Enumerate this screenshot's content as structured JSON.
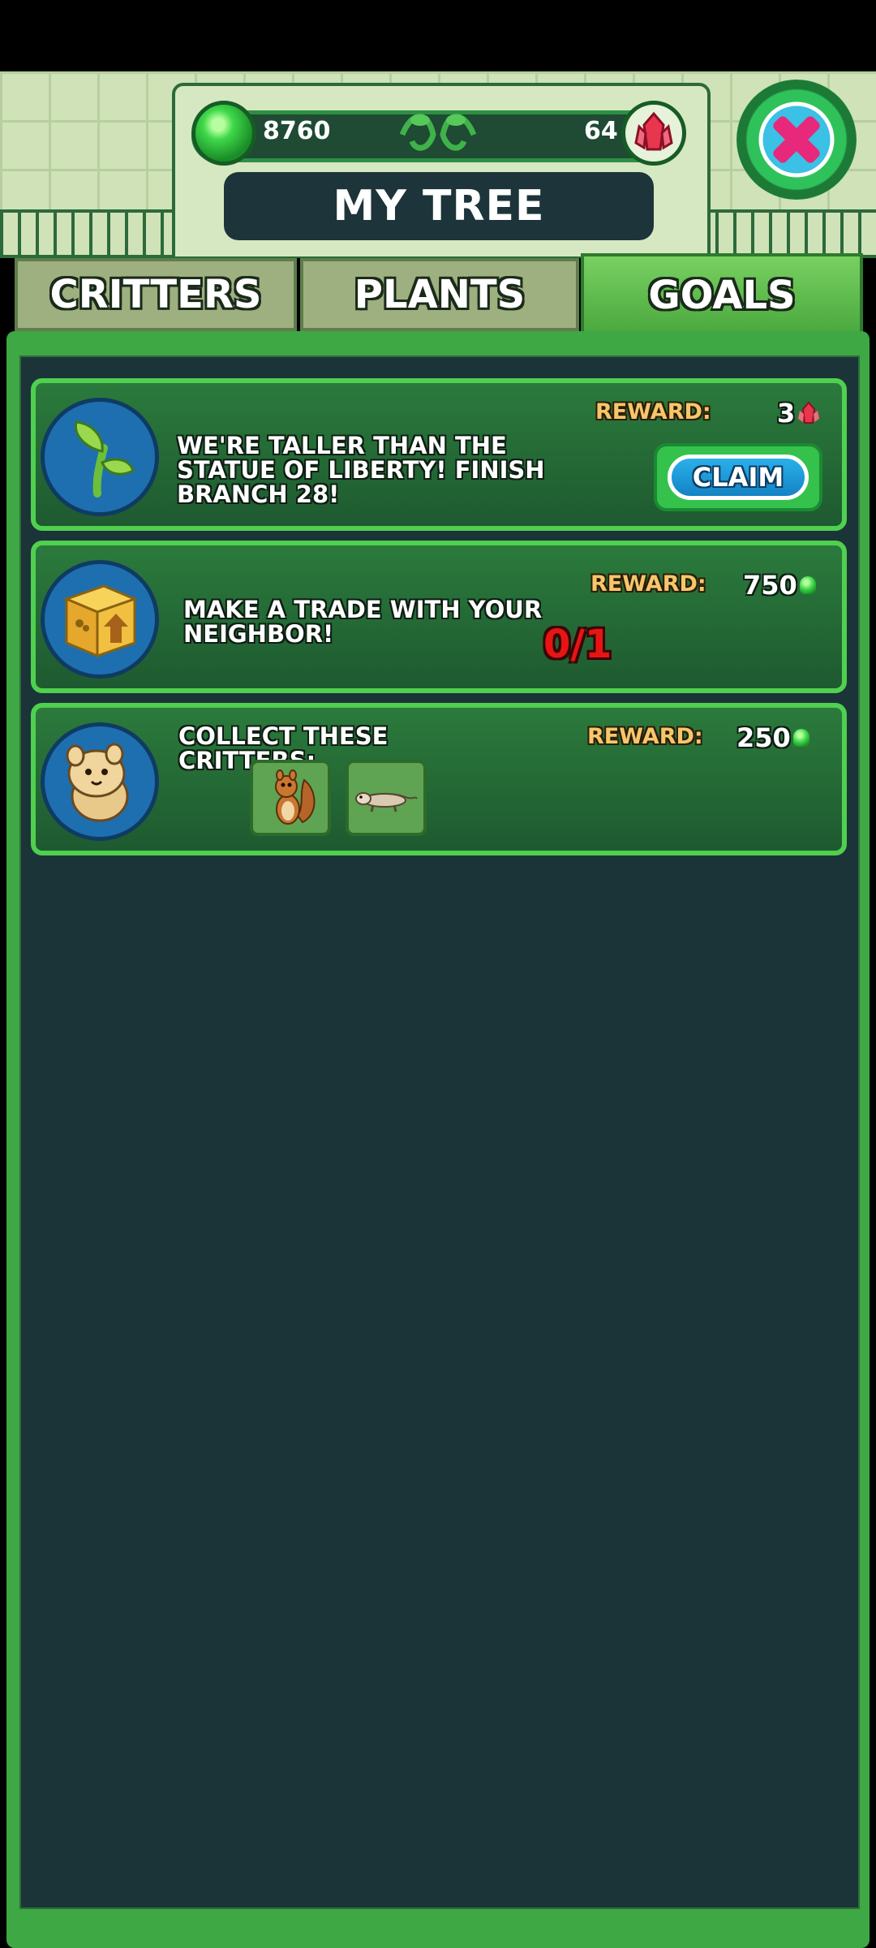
{
  "header": {
    "title": "MY TREE",
    "green_gems": "8760",
    "red_gems": "64"
  },
  "tabs": [
    {
      "label": "CRITTERS",
      "active": false
    },
    {
      "label": "PLANTS",
      "active": false
    },
    {
      "label": "GOALS",
      "active": true
    }
  ],
  "goals": [
    {
      "icon": "sprout-icon",
      "text": "WE'RE TALLER THAN THE STATUE OF LIBERTY!  FINISH BRANCH 28!",
      "reward_label": "REWARD:",
      "reward_value": "3",
      "reward_icon": "red-gem-icon",
      "button_label": "CLAIM"
    },
    {
      "icon": "trade-box-icon",
      "text": "MAKE A TRADE WITH YOUR NEIGHBOR!",
      "reward_label": "REWARD:",
      "reward_value": "750",
      "reward_icon": "green-gem-icon",
      "progress": "0/1"
    },
    {
      "icon": "critter-icon",
      "text": "COLLECT THESE CRITTERS:",
      "reward_label": "REWARD:",
      "reward_value": "250",
      "reward_icon": "green-gem-icon",
      "critters": [
        "squirrel-icon",
        "ferret-icon"
      ]
    }
  ],
  "colors": {
    "panel_bg": "#1b3438",
    "card_border": "#4fd04e",
    "reward_label": "#f6c66b",
    "progress": "#e81414"
  }
}
